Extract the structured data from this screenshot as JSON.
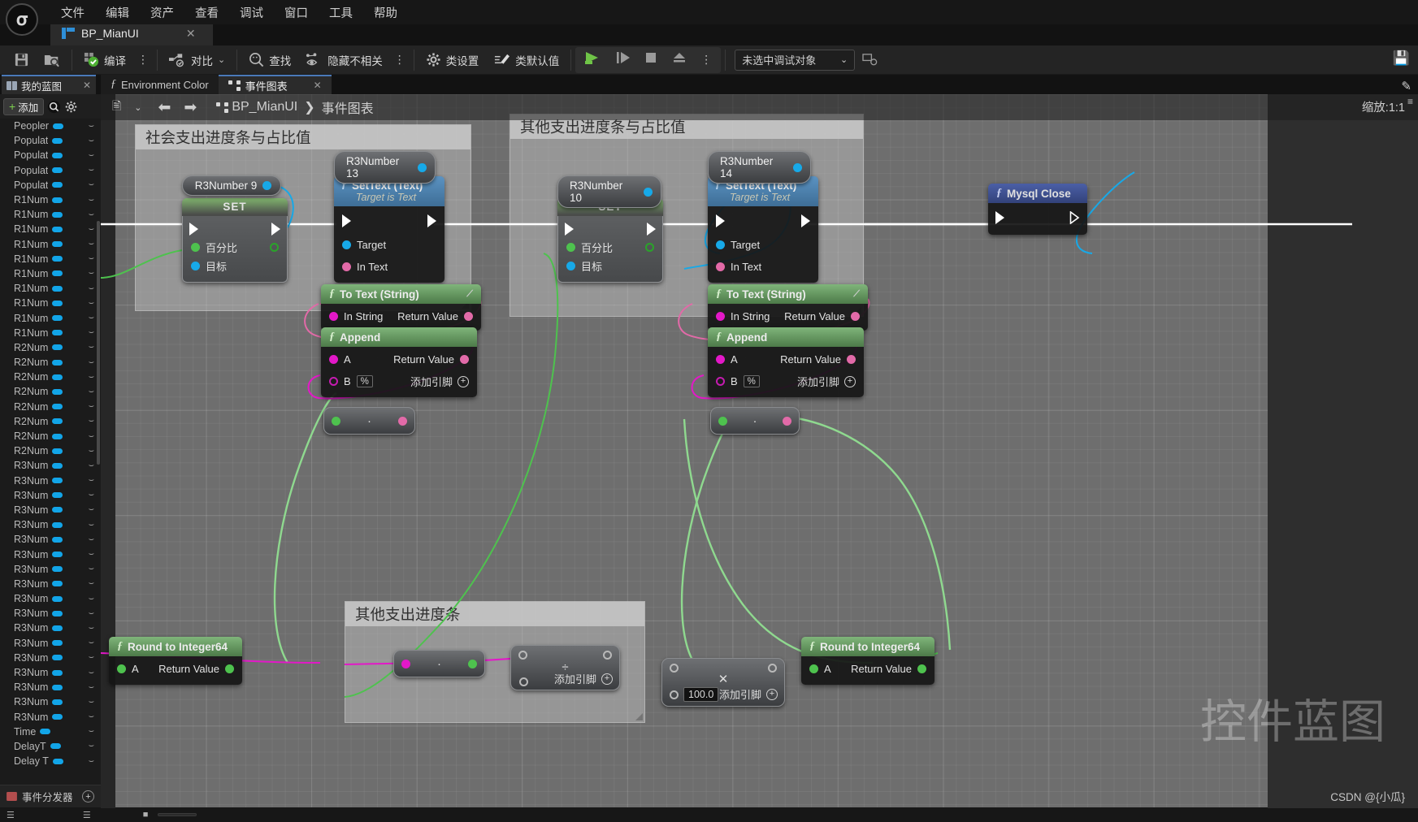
{
  "app": {
    "logo": "unreal-logo",
    "menu": [
      "文件",
      "编辑",
      "资产",
      "查看",
      "调试",
      "窗口",
      "工具",
      "帮助"
    ],
    "asset_tab": {
      "label": "BP_MianUI",
      "close": "✕",
      "icon": "blueprint-icon"
    }
  },
  "toolbar": {
    "save_icon": "save-icon",
    "browse_icon": "browse-content-icon",
    "compile_label": "编译",
    "compile_icon": "compile-check-icon",
    "diff_label": "对比",
    "diff_icon": "diff-icon",
    "find_label": "查找",
    "find_icon": "search-icon",
    "hide_unrelated_label": "隐藏不相关",
    "hide_unrelated_icon": "eye-node-icon",
    "class_settings_label": "类设置",
    "class_settings_icon": "gear-icon",
    "class_defaults_label": "类默认值",
    "class_defaults_icon": "pencil-icon",
    "play_icon": "play-icon",
    "step_icon": "step-icon",
    "stop_icon": "stop-icon",
    "eject_icon": "eject-icon",
    "more_icon": "kebab-icon",
    "debug_object": "未选中调试对象",
    "debug_caret": "⌄",
    "debug_extra_icon": "debug-filter-icon"
  },
  "left_panel": {
    "tab_label": "我的蓝图",
    "tab_close": "✕",
    "tab_icon": "book-icon",
    "add_label": "添加",
    "add_plus": "+",
    "search_icon": "search-icon",
    "settings_icon": "gear-icon",
    "dispatcher_label": "事件分发器",
    "dispatcher_plus": "+",
    "variables": [
      "Peopler",
      "Populat",
      "Populat",
      "Populat",
      "Populat",
      "R1Num",
      "R1Num",
      "R1Num",
      "R1Num",
      "R1Num",
      "R1Num",
      "R1Num",
      "R1Num",
      "R1Num",
      "R1Num",
      "R2Num",
      "R2Num",
      "R2Num",
      "R2Num",
      "R2Num",
      "R2Num",
      "R2Num",
      "R2Num",
      "R3Num",
      "R3Num",
      "R3Num",
      "R3Num",
      "R3Num",
      "R3Num",
      "R3Num",
      "R3Num",
      "R3Num",
      "R3Num",
      "R3Num",
      "R3Num",
      "R3Num",
      "R3Num",
      "R3Num",
      "R3Num",
      "R3Num",
      "R3Num",
      "Time",
      "DelayT",
      "Delay T"
    ]
  },
  "graph_tabs": [
    {
      "label": "Environment Color",
      "icon": "function-icon",
      "active": false
    },
    {
      "label": "事件图表",
      "icon": "graph-icon",
      "active": true,
      "close": "✕"
    }
  ],
  "graph_topbar": {
    "snapshot_icon": "snapshot-icon",
    "caret": "⌄",
    "back_icon": "arrow-left-icon",
    "forward_icon": "arrow-right-icon",
    "crumb_icon": "graph-icon",
    "crumb_root": "BP_MianUI",
    "crumb_sep": "❯",
    "crumb_leaf": "事件图表",
    "zoom_label": "缩放:1:1"
  },
  "comments": [
    {
      "title": "社会支出进度条与占比值"
    },
    {
      "title": "其他支出进度条与占比值"
    },
    {
      "title": "其他支出进度条"
    }
  ],
  "nodes": {
    "var_r3number9": {
      "label": "R3Number 9"
    },
    "var_r3number13": {
      "label": "R3Number 13"
    },
    "var_r3number10": {
      "label": "R3Number 10"
    },
    "var_r3number14": {
      "label": "R3Number 14"
    },
    "set_left": {
      "title": "SET",
      "pin_percent": "百分比",
      "pin_target": "目标"
    },
    "set_right": {
      "title": "SET",
      "pin_percent": "百分比",
      "pin_target": "目标"
    },
    "settext_left": {
      "title": "SetText (Text)",
      "subtitle": "Target is Text",
      "pin_target": "Target",
      "pin_intext": "In Text"
    },
    "settext_right": {
      "title": "SetText (Text)",
      "subtitle": "Target is Text",
      "pin_target": "Target",
      "pin_intext": "In Text"
    },
    "totext_left": {
      "title": "To Text (String)",
      "pin_in": "In String",
      "pin_out": "Return Value"
    },
    "totext_right": {
      "title": "To Text (String)",
      "pin_in": "In String",
      "pin_out": "Return Value"
    },
    "append_left": {
      "title": "Append",
      "pin_a": "A",
      "pin_b": "B",
      "b_value": "%",
      "pin_out": "Return Value",
      "add_pin": "添加引脚",
      "add_icon": "⊕"
    },
    "append_right": {
      "title": "Append",
      "pin_a": "A",
      "pin_b": "B",
      "b_value": "%",
      "pin_out": "Return Value",
      "add_pin": "添加引脚",
      "add_icon": "⊕"
    },
    "mysql_close": {
      "title": "Mysql Close",
      "icon": "function-icon"
    },
    "round_left": {
      "title": "Round to Integer64",
      "pin_a": "A",
      "pin_out": "Return Value",
      "icon": "function-icon"
    },
    "round_right": {
      "title": "Round to Integer64",
      "pin_a": "A",
      "pin_out": "Return Value",
      "icon": "function-icon"
    },
    "mult_left": {
      "op": "·"
    },
    "mult_right": {
      "op": "·"
    },
    "mult_bottom": {
      "op": "·"
    },
    "divide_bottom": {
      "op": "÷",
      "add_pin": "添加引脚",
      "add_icon": "⊕"
    },
    "multiply_bottom": {
      "op": "✕",
      "value": "100.0",
      "add_pin": "添加引脚",
      "add_icon": "⊕"
    }
  },
  "watermark": {
    "big": "控件蓝图",
    "credit": "CSDN @{小瓜}"
  },
  "colors": {
    "accent_blue": "#17a9e8",
    "exec_white": "#ffffff",
    "pink": "#e26aa8",
    "magenta": "#e318c8",
    "green": "#4ec24e",
    "tab_highlight": "#4a79b8"
  }
}
